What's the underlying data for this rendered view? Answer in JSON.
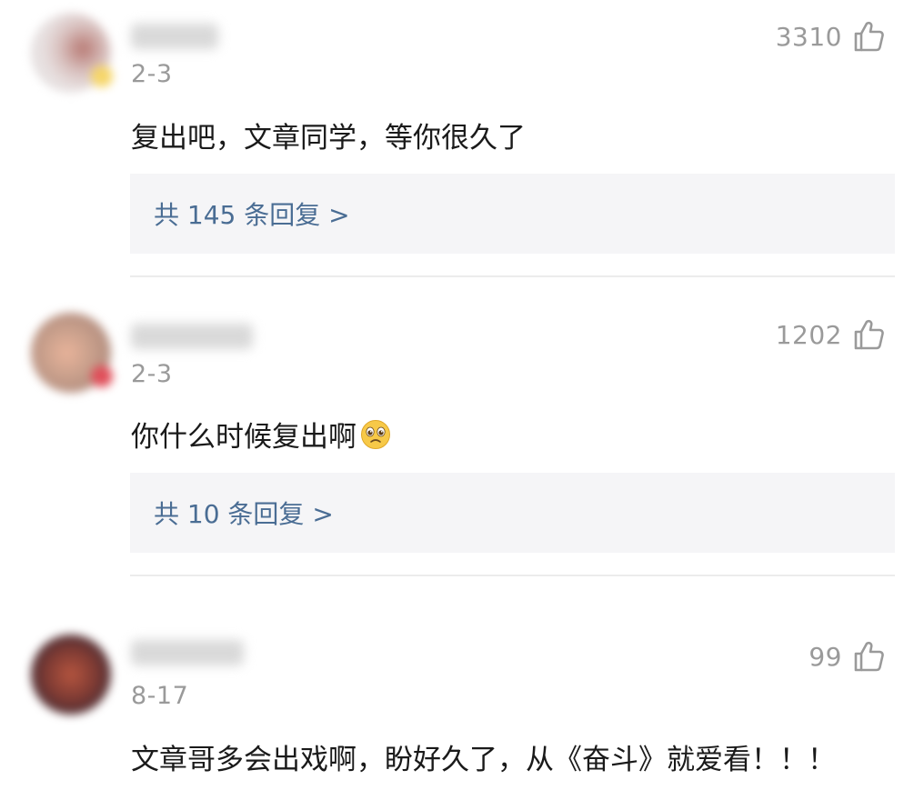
{
  "comments": [
    {
      "date": "2-3",
      "likes": "3310",
      "text": "复出吧，文章同学，等你很久了",
      "replies": "共 145 条回复 >"
    },
    {
      "date": "2-3",
      "likes": "1202",
      "text": "你什么时候复出啊",
      "emoji": "pleading-face-icon",
      "replies": "共 10 条回复 >"
    },
    {
      "date": "8-17",
      "likes": "99",
      "text": "文章哥多会出戏啊，盼好久了，从《奋斗》就爱看！！！"
    }
  ],
  "colors": {
    "reply_link": "#4a6d94",
    "reply_bg": "#f5f5f7",
    "meta_gray": "#9a9a9a"
  }
}
